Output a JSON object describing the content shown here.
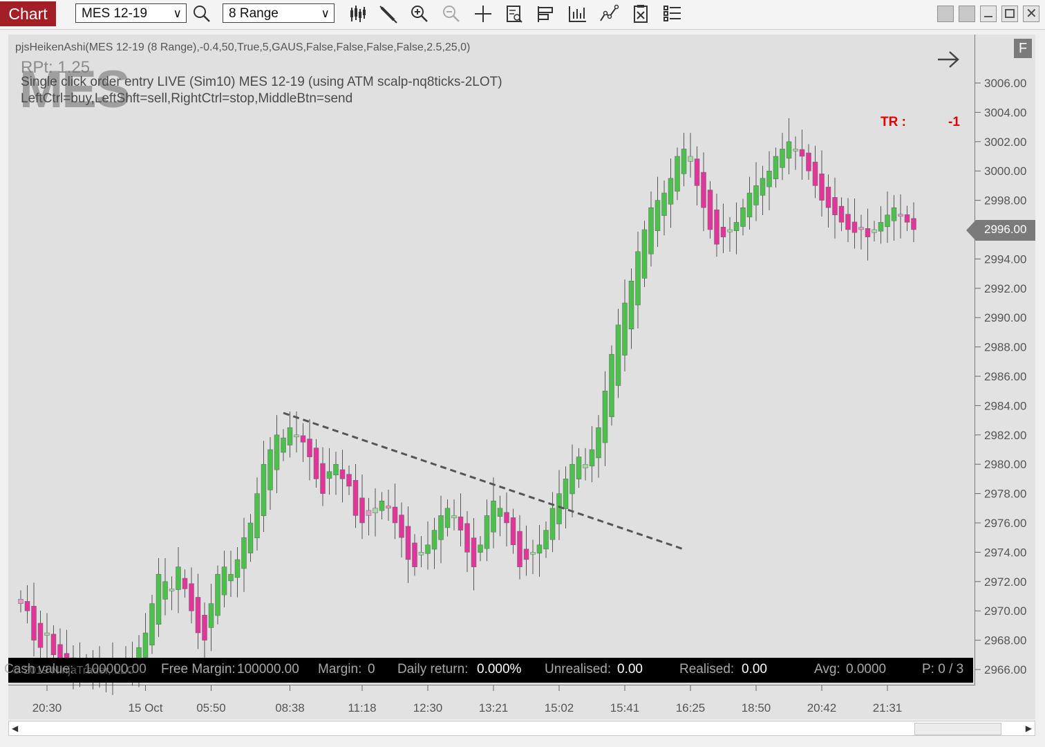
{
  "toolbar": {
    "chart_tab": "Chart",
    "instrument": "MES 12-19",
    "interval": "8 Range",
    "icons": [
      "search-icon",
      "bar-type-icon",
      "draw-icon",
      "zoom-in-icon",
      "zoom-out-icon",
      "crosshair-icon",
      "data-box-icon",
      "template-icon",
      "indicators-icon",
      "strategies-icon",
      "properties-icon",
      "list-icon"
    ],
    "window_buttons": [
      "tile-icon",
      "tile2-icon",
      "minimize-icon",
      "maximize-icon",
      "close-icon"
    ]
  },
  "chart": {
    "indicator_label": "pjsHeikenAshi(MES 12-19 (8 Range),-0.4,50,True,5,GAUS,False,False,False,False,2.5,25,0)",
    "watermark": "MES",
    "rpt_label": "RPt: 1.25",
    "order_entry_line": "Single click order entry LIVE (Sim10) MES 12-19 (using ATM scalp-nq8ticks-2LOT)",
    "mouse_help_line": "LeftCtrl=buy,LeftShft=sell,RightCtrl=stop,MiddleBtn=send",
    "tr_label": "TR :",
    "tr_value": "-1",
    "f_button": "F",
    "price_marker": "2996.00",
    "colors": {
      "up": "#4cbf4c",
      "up_light": "#a6d9a0",
      "down": "#e0369a",
      "down_light": "#e89ac6",
      "trendline": "#555555",
      "tr": "#e60000"
    }
  },
  "infobar": {
    "cash_label": "Cash value:",
    "cash_value": "100000.00",
    "copyright": "© 2019 NinjaTrader, LLC",
    "free_margin_label": "Free Margin:",
    "free_margin_value": "100000.00",
    "margin_label": "Margin:",
    "margin_value": "0",
    "daily_label": "Daily return:",
    "daily_value": "0.000%",
    "unrealised_label": "Unrealised:",
    "unrealised_value": "0.00",
    "realised_label": "Realised:",
    "realised_value": "0.00",
    "avg_label": "Avg:",
    "avg_value": "0.0000",
    "position_label": "P: 0 / 3"
  },
  "chart_data": {
    "type": "candlestick",
    "title": "",
    "y_ticks": [
      3006,
      3004,
      3002,
      3000,
      2998,
      2996,
      2994,
      2992,
      2990,
      2988,
      2986,
      2984,
      2982,
      2980,
      2978,
      2976,
      2974,
      2972,
      2970,
      2968,
      2966
    ],
    "y_tick_labels": [
      "3006.00",
      "3004.00",
      "3002.00",
      "3000.00",
      "2998.00",
      "2996.00",
      "2994.00",
      "2992.00",
      "2990.00",
      "2988.00",
      "2986.00",
      "2984.00",
      "2982.00",
      "2980.00",
      "2978.00",
      "2976.00",
      "2974.00",
      "2972.00",
      "2970.00",
      "2968.00",
      "2966.00"
    ],
    "ylim": [
      2965.2,
      3008.9
    ],
    "x_tick_labels": [
      "20:30",
      "15 Oct",
      "05:50",
      "08:38",
      "11:18",
      "12:30",
      "13:21",
      "15:02",
      "15:41",
      "16:25",
      "18:50",
      "20:42",
      "21:31"
    ],
    "x_tick_bar_index": [
      4,
      19,
      29,
      41,
      52,
      62,
      72,
      82,
      92,
      102,
      112,
      122,
      132
    ],
    "trendline": {
      "start_bar": 40,
      "start_price": 2983.5,
      "end_bar": 101,
      "end_price": 2974.2
    },
    "closes": [
      2970.5,
      2970.0,
      2968.0,
      2967.5,
      2968.5,
      2967.0,
      2966.5,
      2966.5,
      2966.0,
      2966.5,
      2966.0,
      2965.5,
      2966.0,
      2965.8,
      2966.5,
      2966.0,
      2966.5,
      2966.0,
      2967.5,
      2968.5,
      2970.5,
      2972.5,
      2972.0,
      2971.5,
      2973.0,
      2971.5,
      2970.0,
      2968.5,
      2968.0,
      2970.5,
      2972.5,
      2973.0,
      2972.5,
      2973.5,
      2975.0,
      2976.0,
      2978.0,
      2980.0,
      2981.0,
      2982.0,
      2981.8,
      2982.5,
      2982.0,
      2981.5,
      2980.5,
      2979.0,
      2978.0,
      2979.5,
      2980.0,
      2979.0,
      2978.5,
      2976.5,
      2976.0,
      2976.5,
      2977.0,
      2977.5,
      2977.0,
      2976.0,
      2975.0,
      2973.5,
      2973.0,
      2974.0,
      2974.5,
      2975.5,
      2976.5,
      2977.0,
      2976.5,
      2975.5,
      2974.0,
      2973.0,
      2974.5,
      2976.5,
      2977.5,
      2977.0,
      2976.0,
      2974.5,
      2973.0,
      2973.5,
      2974.0,
      2974.5,
      2975.5,
      2977.0,
      2978.0,
      2979.0,
      2980.0,
      2980.5,
      2980.0,
      2981.0,
      2982.5,
      2985.0,
      2987.5,
      2989.5,
      2991.0,
      2992.5,
      2994.5,
      2996.0,
      2997.5,
      2998.0,
      2998.5,
      2999.5,
      3001.0,
      3001.5,
      3001.0,
      2999.0,
      2997.5,
      2996.0,
      2995.0,
      2995.5,
      2996.0,
      2996.5,
      2997.5,
      2998.5,
      2999.0,
      2999.5,
      3000.0,
      3001.0,
      3001.5,
      3002.0,
      3001.5,
      3001.0,
      3000.0,
      2999.0,
      2998.0,
      2997.5,
      2997.0,
      2996.5,
      2996.0,
      2995.8,
      2996.0,
      2995.5,
      2996.0,
      2996.5,
      2997.0,
      2997.5,
      2997.0,
      2996.5,
      2996.0
    ]
  }
}
